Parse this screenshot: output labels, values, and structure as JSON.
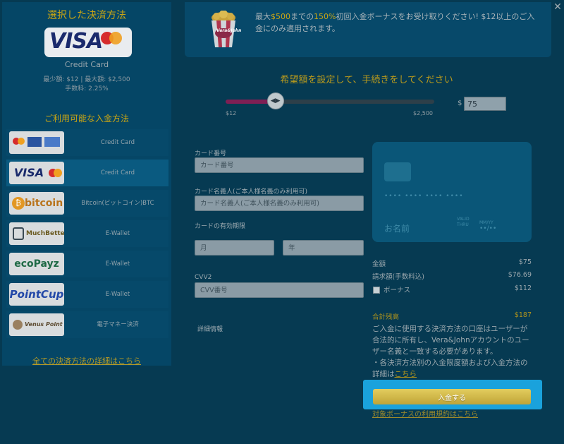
{
  "selected_method": {
    "title": "選択した決済方法",
    "name": "Credit Card",
    "limits": "最少額: $12 | 最大額: $2,500",
    "fee": "手数料: 2.25%"
  },
  "available_methods": {
    "title": "ご利用可能な入金方法",
    "items": [
      {
        "logo": "credit-card-logos",
        "label": "Credit Card"
      },
      {
        "logo": "VISA",
        "label": "Credit Card"
      },
      {
        "logo": "bitcoin",
        "label": "Bitcoin(ビットコイン)BTC"
      },
      {
        "logo": "MuchBetter",
        "label": "E-Wallet"
      },
      {
        "logo": "ecoPayz",
        "label": "E-Wallet"
      },
      {
        "logo": "PointCup",
        "label": "E-Wallet"
      },
      {
        "logo": "Venus Point",
        "label": "電子マネー決済"
      }
    ],
    "all_link": "全ての決済方法の詳細はこちら"
  },
  "promo": {
    "cup_text": "Vera&John",
    "text_1": "最大",
    "amount": "$500",
    "text_2": "までの",
    "percent": "150%",
    "text_3": "初回入金ボーナスをお受け取りください! $12以上のご入金にのみ適用されます。"
  },
  "amount_section": {
    "title": "希望額を設定して、手続きをしてください",
    "min_label": "$12",
    "max_label": "$2,500",
    "min_value": 12,
    "max_value": 2500,
    "currency": "$",
    "value": "75"
  },
  "form": {
    "card_number_label": "カード番号",
    "card_number_placeholder": "カード番号",
    "holder_label": "カード名義人(ご本人様名義のみ利用可)",
    "holder_placeholder": "カード名義人(ご本人様名義のみ利用可)",
    "expiry_label": "カードの有効期限",
    "month_placeholder": "月",
    "year_placeholder": "年",
    "cvv_label": "CVV2",
    "cvv_placeholder": "CVV番号",
    "details_label": "詳細情報"
  },
  "card_preview": {
    "number_mask": "•••• •••• •••• ••••",
    "name_placeholder": "お名前",
    "valid_label_1": "VALID",
    "valid_label_2": "THRU",
    "expiry_format": "MM/YY",
    "expiry_mask": "••/••"
  },
  "summary": {
    "amount_label": "金額",
    "amount_value": "$75",
    "billing_label": "請求額(手数料込)",
    "billing_value": "$76.69",
    "bonus_label": "ボーナス",
    "bonus_value": "$112",
    "total_label": "合計残高",
    "total_value": "$187",
    "notice": "ご入金に使用する決済方法の口座はユーザーが合法的に所有し、Vera&Johnアカウントのユーザー名義と一致する必要があります。",
    "notice_2": "・各決済方法別の入金限度額および入金方法の詳細は",
    "notice_link": "こちら",
    "deposit_button": "入金する",
    "terms_link": "対象ボーナスの利用規約はこちら"
  },
  "colors": {
    "accent_gold": "#c9a514",
    "highlight_blue": "#1aa2dc",
    "slider_fill": "#7f1f54"
  }
}
